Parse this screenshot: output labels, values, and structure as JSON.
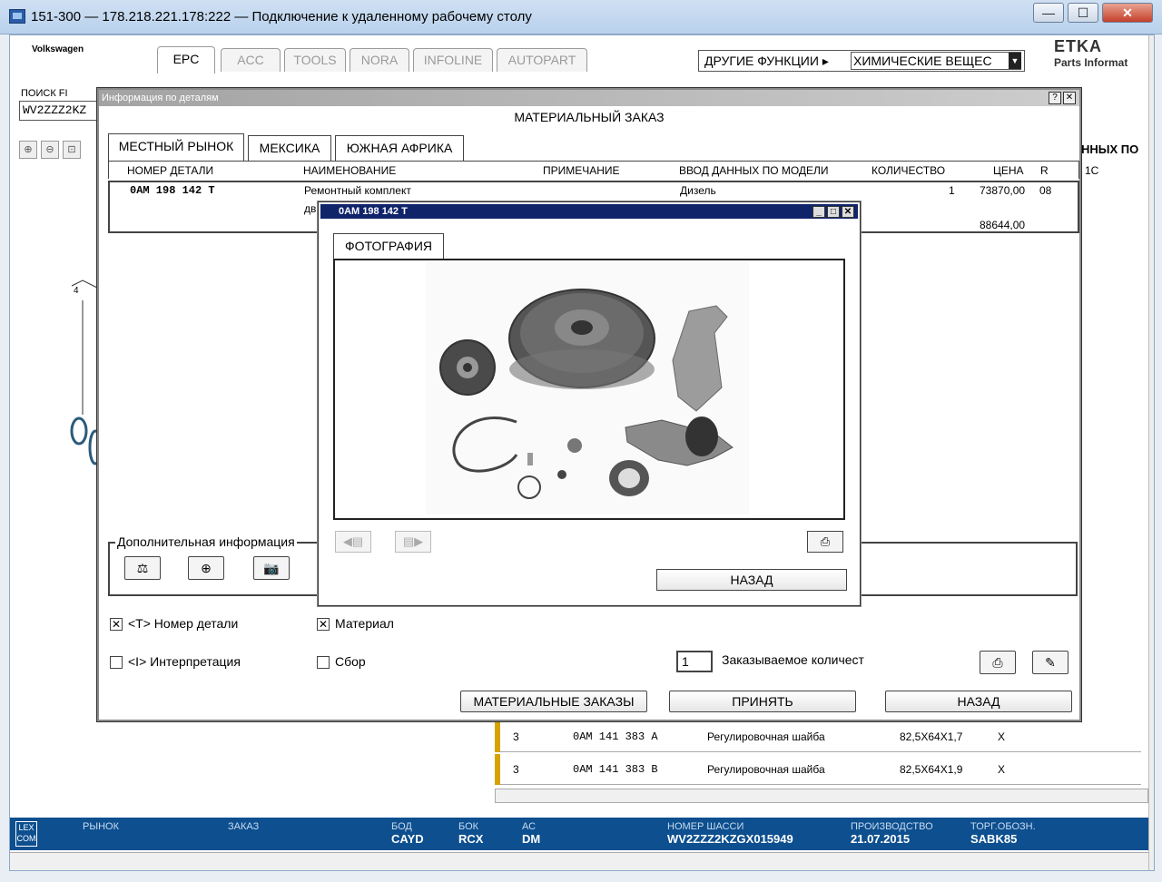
{
  "window": {
    "title": "151-300 — 178.218.221.178:222 — Подключение к удаленному рабочему столу",
    "min": "—",
    "max": "☐",
    "close": "✕"
  },
  "app": {
    "brand": "Volkswagen",
    "tabs": [
      "EPC",
      "ACC",
      "TOOLS",
      "NORA",
      "INFOLINE",
      "AUTOPART"
    ],
    "other_functions_label": "ДРУГИЕ ФУНКЦИИ ▸",
    "chem_select_value": "ХИМИЧЕСКИЕ ВЕЩЕС",
    "lexcom_title": "ETKA",
    "lexcom_sub": "Parts Informat",
    "search_label": "ПОИСК FI",
    "search_value": "WV2ZZZ2KZ",
    "right_fragment": "ННЫХ ПО",
    "right_fragment2": "1C"
  },
  "info_dialog": {
    "title": "Информация по деталям",
    "help_btn": "?",
    "close_btn": "✕",
    "heading": "МАТЕРИАЛЬНЫЙ ЗАКАЗ",
    "market_tabs": [
      "МЕСТНЫЙ РЫНОК",
      "МЕКСИКА",
      "ЮЖНАЯ АФРИКА"
    ],
    "columns": [
      "НОМЕР ДЕТАЛИ",
      "НАИМЕНОВАНИЕ",
      "ПРИМЕЧАНИЕ",
      "ВВОД ДАННЫХ ПО МОДЕЛИ",
      "КОЛИЧЕСТВО",
      "ЦЕНА",
      "R"
    ],
    "row": {
      "part_no": "0AM 198 142 T",
      "name": "Ремонтный комплект",
      "name_line2": "дв",
      "model": "Дизель",
      "qty": "1",
      "price": "73870,00",
      "r": "08",
      "price2": "88644,00"
    },
    "additional_info_title": "Дополнительная информация",
    "checkboxes": [
      {
        "label": "<T> Номер детали",
        "checked": true
      },
      {
        "label": "Материал",
        "checked": true
      },
      {
        "label": "<I> Интерпретация",
        "checked": false
      },
      {
        "label": "Сбор",
        "checked": false
      }
    ],
    "order_qty": "1",
    "order_qty_label": "Заказываемое количест",
    "buttons": {
      "material_orders": "МАТЕРИАЛЬНЫЕ ЗАКАЗЫ",
      "accept": "ПРИНЯТЬ",
      "back": "НАЗАД"
    }
  },
  "photo_dialog": {
    "title": "0AM 198 142 T",
    "tab": "ФОТОГРАФИЯ",
    "back": "НАЗАД"
  },
  "background_list": [
    {
      "pos": "3",
      "part": "0AM 141 383 A",
      "name": "Регулировочная шайба",
      "spec": "82,5X64X1,7",
      "mark": "X"
    },
    {
      "pos": "3",
      "part": "0AM 141 383 B",
      "name": "Регулировочная шайба",
      "spec": "82,5X64X1,9",
      "mark": "X"
    }
  ],
  "diagram_label": "4",
  "status_bar": {
    "market_label": "РЫНОК",
    "order_label": "ЗАКАЗ",
    "body_label": "БОД",
    "body_value": "CAYD",
    "box_label": "БОК",
    "box_value": "RCX",
    "ac_label": "АС",
    "ac_value": "DM",
    "chassis_label": "НОМЕР ШАССИ",
    "chassis_value": "WV2ZZZ2KZGX015949",
    "production_label": "ПРОИЗВОДСТВО",
    "production_value": "21.07.2015",
    "trade_label": "ТОРГ.ОБОЗН.",
    "trade_value": "SABK85",
    "logo": "LEX COM"
  },
  "colors": {
    "status_bar": "#0d4f8f",
    "photo_title_bar": "#10246a",
    "highlight_bar": "#d8a300"
  }
}
